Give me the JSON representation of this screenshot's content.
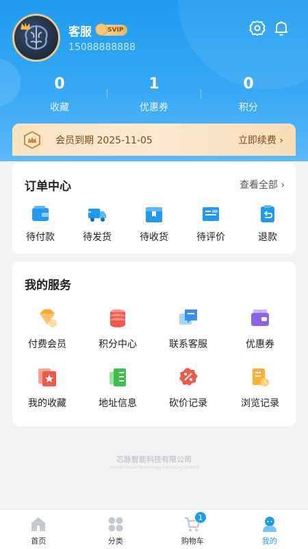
{
  "profile": {
    "name": "客服",
    "vip_label": "SVIP",
    "phone": "15088888888"
  },
  "stats": [
    {
      "value": "0",
      "label": "收藏"
    },
    {
      "value": "1",
      "label": "优惠券"
    },
    {
      "value": "0",
      "label": "积分"
    }
  ],
  "member": {
    "expiry_text": "会员到期 2025-11-05",
    "renew_label": "立即续费 ›"
  },
  "orders": {
    "title": "订单中心",
    "view_all": "查看全部 ›",
    "items": [
      {
        "label": "待付款",
        "icon": "wallet-icon"
      },
      {
        "label": "待发货",
        "icon": "truck-icon"
      },
      {
        "label": "待收货",
        "icon": "box-icon"
      },
      {
        "label": "待评价",
        "icon": "review-icon"
      },
      {
        "label": "退款",
        "icon": "refund-icon"
      }
    ]
  },
  "services": {
    "title": "我的服务",
    "items": [
      {
        "label": "付费会员",
        "icon": "diamond-icon"
      },
      {
        "label": "积分中心",
        "icon": "coins-icon"
      },
      {
        "label": "联系客服",
        "icon": "chat-icon"
      },
      {
        "label": "优惠券",
        "icon": "coupon-wallet-icon"
      },
      {
        "label": "我的收藏",
        "icon": "star-card-icon"
      },
      {
        "label": "地址信息",
        "icon": "address-book-icon"
      },
      {
        "label": "砍价记录",
        "icon": "discount-icon"
      },
      {
        "label": "浏览记录",
        "icon": "history-doc-icon"
      }
    ]
  },
  "footer": {
    "company": "芯脉智能科技有限公司",
    "company_en": "Xinmai Smart Technology Company Limited"
  },
  "tabbar": {
    "items": [
      {
        "label": "首页",
        "icon": "home-icon"
      },
      {
        "label": "分类",
        "icon": "category-icon"
      },
      {
        "label": "购物车",
        "icon": "cart-icon"
      },
      {
        "label": "我的",
        "icon": "profile-icon"
      }
    ],
    "cart_count": "1",
    "active_index": 3
  },
  "colors": {
    "primary": "#1e9bf0",
    "member_text": "#7a4a1e"
  }
}
